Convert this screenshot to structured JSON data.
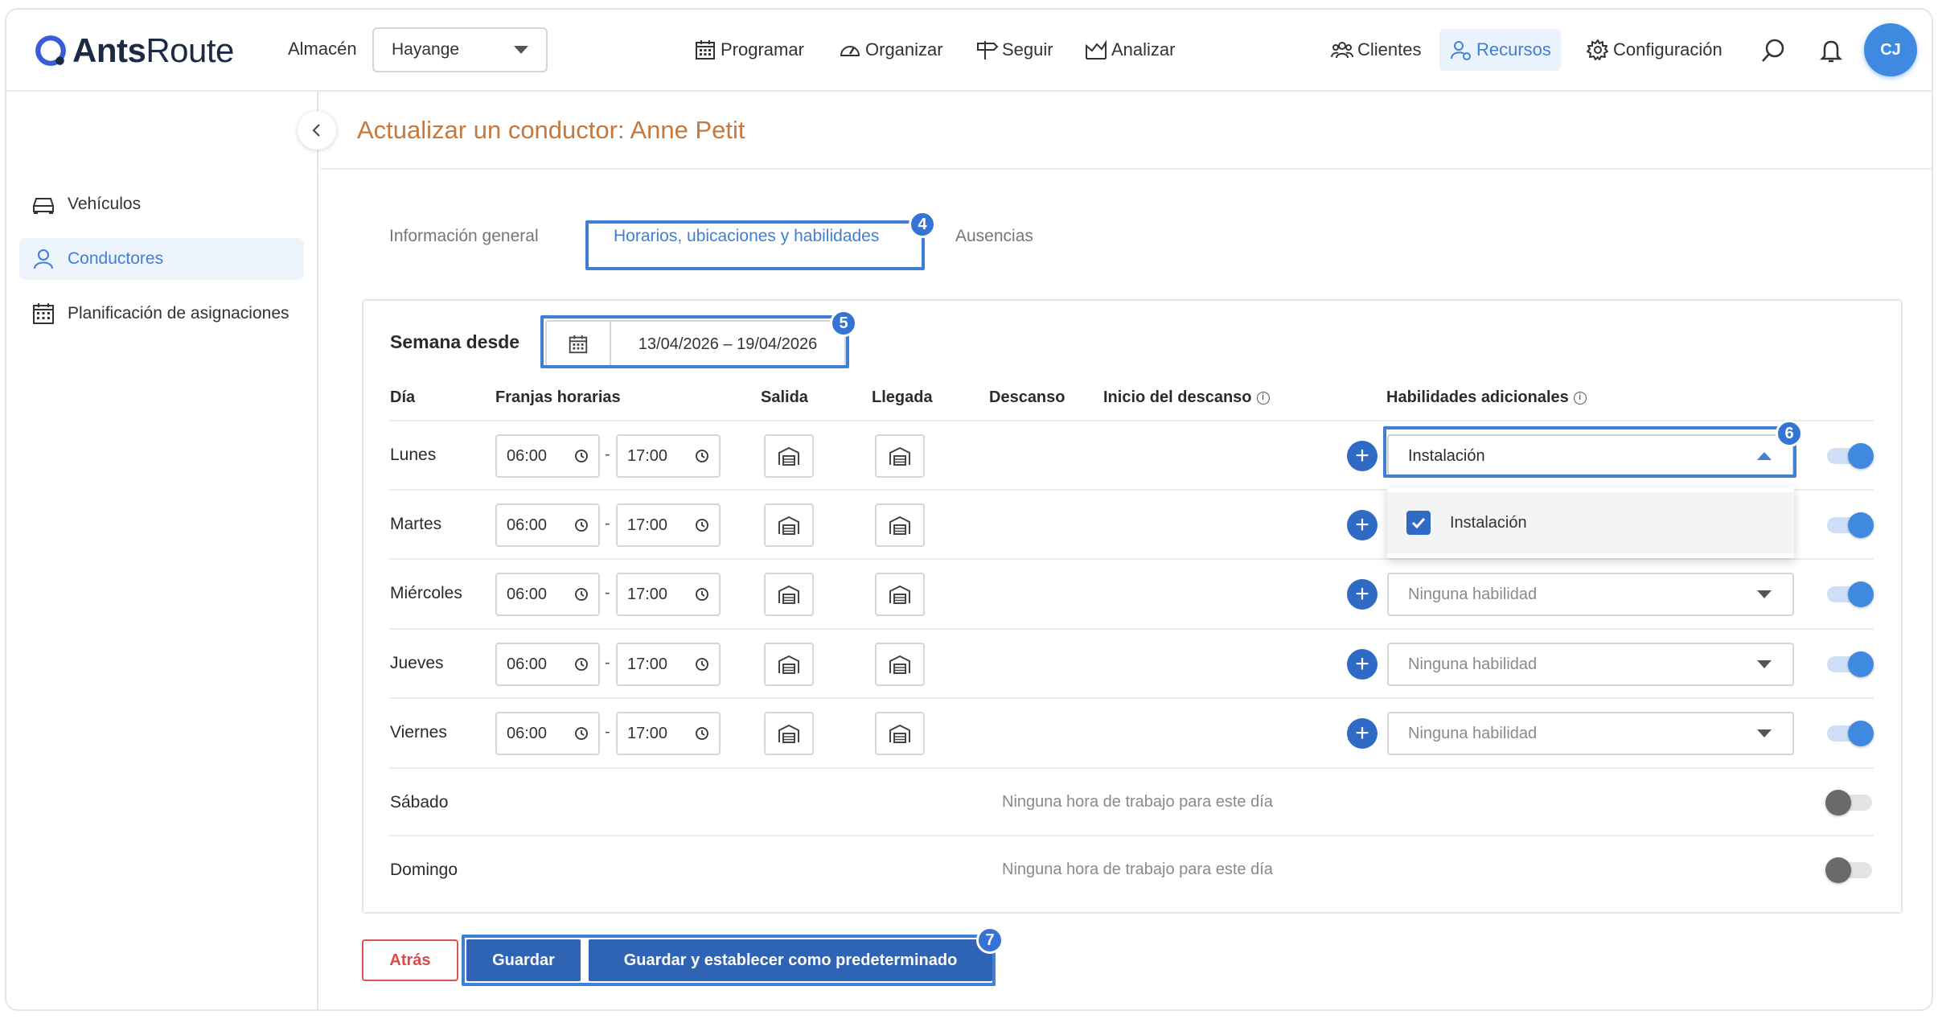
{
  "app": {
    "name_bold": "Ants",
    "name_light": "Route"
  },
  "header": {
    "warehouse_label": "Almacén",
    "warehouse_value": "Hayange",
    "nav": [
      {
        "label": "Programar",
        "icon": "calendar-icon"
      },
      {
        "label": "Organizar",
        "icon": "gauge-icon"
      },
      {
        "label": "Seguir",
        "icon": "signpost-icon"
      },
      {
        "label": "Analizar",
        "icon": "chart-icon"
      },
      {
        "label": "Clientes",
        "icon": "users-icon"
      },
      {
        "label": "Recursos",
        "icon": "resources-icon",
        "active": true
      },
      {
        "label": "Configuración",
        "icon": "gear-icon"
      }
    ],
    "avatar_initials": "CJ"
  },
  "sidebar": {
    "items": [
      {
        "label": "Vehículos",
        "icon": "car-icon"
      },
      {
        "label": "Conductores",
        "icon": "user-icon",
        "active": true
      },
      {
        "label": "Planificación de asignaciones",
        "icon": "calendar-icon"
      }
    ]
  },
  "page": {
    "title": "Actualizar un conductor: Anne Petit",
    "tabs": [
      {
        "label": "Información general"
      },
      {
        "label": "Horarios, ubicaciones y habilidades",
        "active": true
      },
      {
        "label": "Ausencias"
      }
    ]
  },
  "schedule": {
    "week_label": "Semana desde",
    "week_range": "13/04/2026 – 19/04/2026",
    "headers": {
      "day": "Día",
      "slots": "Franjas horarias",
      "departure": "Salida",
      "arrival": "Llegada",
      "break": "Descanso",
      "break_start": "Inicio del descanso",
      "skills": "Habilidades adicionales"
    },
    "rows": [
      {
        "day": "Lunes",
        "start": "06:00",
        "end": "17:00",
        "skills": "Instalación",
        "enabled": true
      },
      {
        "day": "Martes",
        "start": "06:00",
        "end": "17:00",
        "skills": "",
        "enabled": true
      },
      {
        "day": "Miércoles",
        "start": "06:00",
        "end": "17:00",
        "skills": "Ninguna habilidad",
        "enabled": true
      },
      {
        "day": "Jueves",
        "start": "06:00",
        "end": "17:00",
        "skills": "Ninguna habilidad",
        "enabled": true
      },
      {
        "day": "Viernes",
        "start": "06:00",
        "end": "17:00",
        "skills": "Ninguna habilidad",
        "enabled": true
      }
    ],
    "off_days": [
      {
        "day": "Sábado",
        "message": "Ninguna hora de trabajo para este día",
        "enabled": false
      },
      {
        "day": "Domingo",
        "message": "Ninguna hora de trabajo para este día",
        "enabled": false
      }
    ],
    "dropdown_option": "Instalación"
  },
  "actions": {
    "back": "Atrás",
    "save": "Guardar",
    "save_default": "Guardar y establecer como predeterminado"
  },
  "annotations": [
    "4",
    "5",
    "6",
    "7"
  ],
  "colors": {
    "accent": "#3f7fd6",
    "title": "#c7783c",
    "primary_button": "#2f63b3",
    "danger": "#d94a4a"
  }
}
